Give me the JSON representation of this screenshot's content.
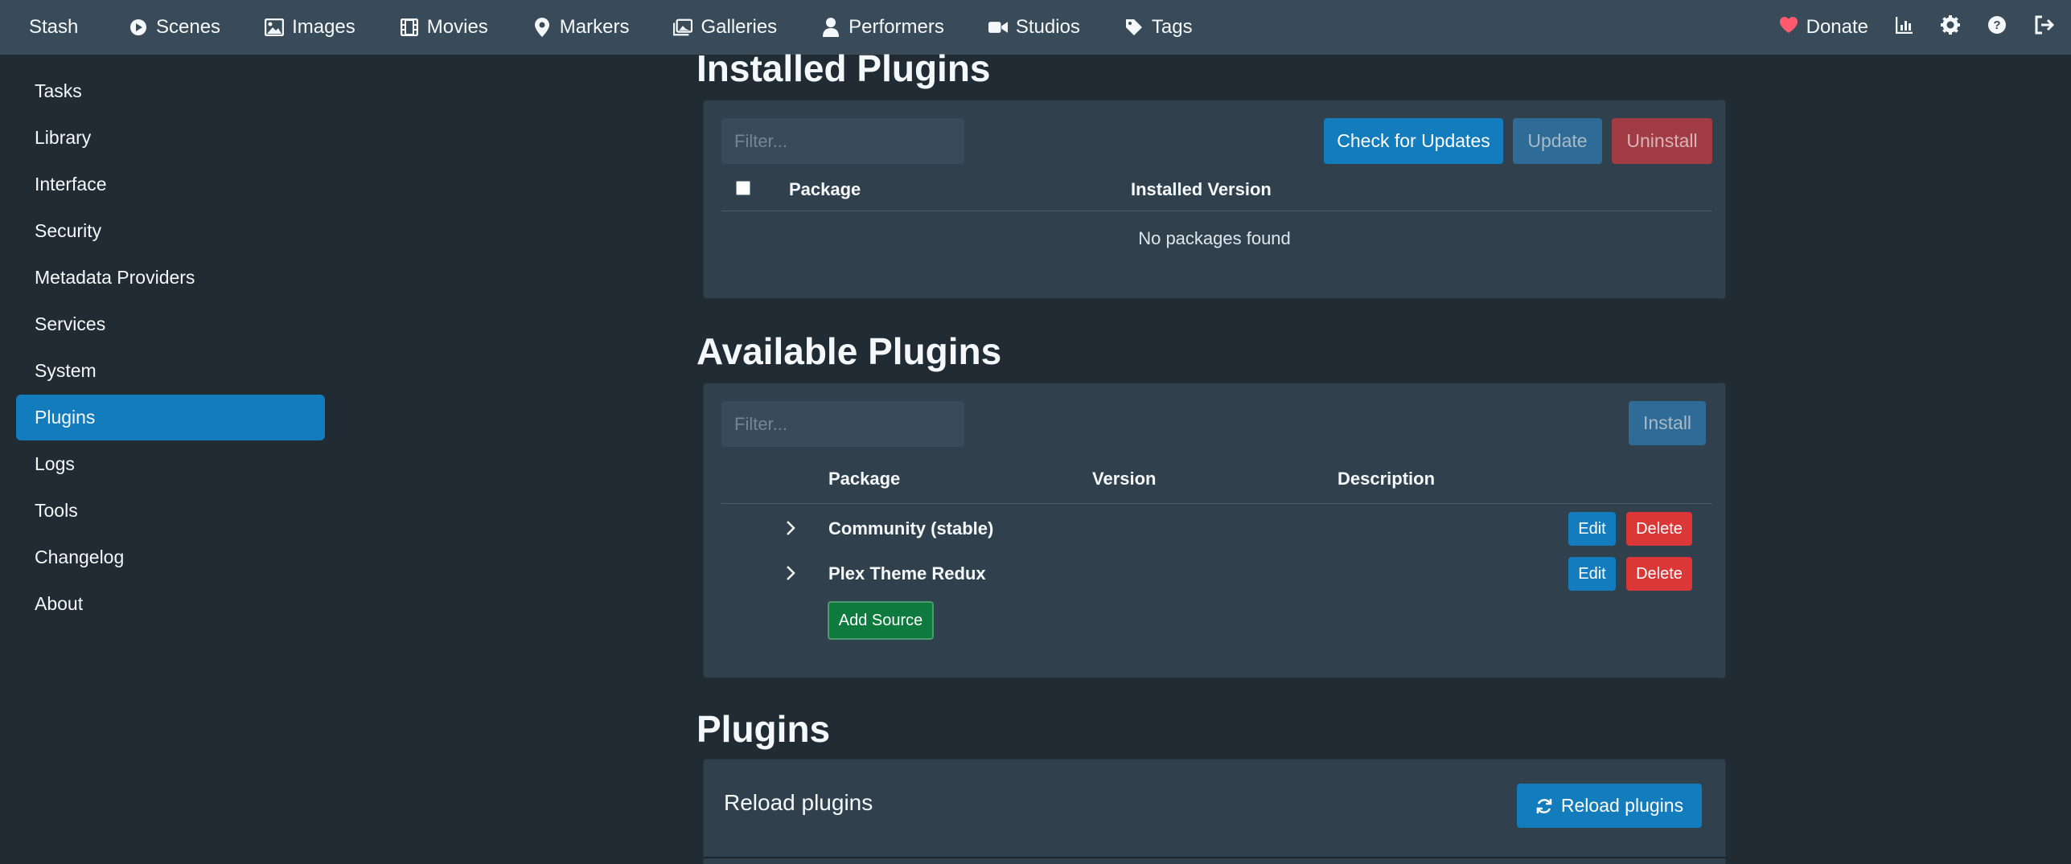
{
  "navbar": {
    "brand": "Stash",
    "items": [
      {
        "label": "Scenes",
        "icon": "play-circle-icon"
      },
      {
        "label": "Images",
        "icon": "image-icon"
      },
      {
        "label": "Movies",
        "icon": "film-icon"
      },
      {
        "label": "Markers",
        "icon": "map-marker-icon"
      },
      {
        "label": "Galleries",
        "icon": "images-icon"
      },
      {
        "label": "Performers",
        "icon": "user-icon"
      },
      {
        "label": "Studios",
        "icon": "video-icon"
      },
      {
        "label": "Tags",
        "icon": "tag-icon"
      }
    ],
    "donate": "Donate",
    "right_icons": [
      "chart-icon",
      "gear-icon",
      "help-icon",
      "logout-icon"
    ]
  },
  "sidebar": {
    "items": [
      {
        "label": "Tasks"
      },
      {
        "label": "Library"
      },
      {
        "label": "Interface"
      },
      {
        "label": "Security"
      },
      {
        "label": "Metadata Providers"
      },
      {
        "label": "Services"
      },
      {
        "label": "System"
      },
      {
        "label": "Plugins",
        "active": true
      },
      {
        "label": "Logs"
      },
      {
        "label": "Tools"
      },
      {
        "label": "Changelog"
      },
      {
        "label": "About"
      }
    ]
  },
  "installed": {
    "title": "Installed Plugins",
    "filter_placeholder": "Filter...",
    "check_updates": "Check for Updates",
    "update": "Update",
    "uninstall": "Uninstall",
    "col_package": "Package",
    "col_installed_version": "Installed Version",
    "empty": "No packages found"
  },
  "available": {
    "title": "Available Plugins",
    "filter_placeholder": "Filter...",
    "install": "Install",
    "col_package": "Package",
    "col_version": "Version",
    "col_description": "Description",
    "sources": [
      {
        "name": "Community (stable)",
        "edit": "Edit",
        "delete": "Delete"
      },
      {
        "name": "Plex Theme Redux",
        "edit": "Edit",
        "delete": "Delete"
      }
    ],
    "add_source": "Add Source"
  },
  "plugins": {
    "title": "Plugins",
    "reload_label": "Reload plugins",
    "reload_button": "Reload plugins"
  },
  "colors": {
    "background": "#202b33",
    "navbar": "#394b59",
    "card": "#30404d",
    "primary": "#137cbd",
    "danger": "#db3737",
    "success": "#0f7a3e",
    "donate_heart": "#ff5a6e"
  }
}
